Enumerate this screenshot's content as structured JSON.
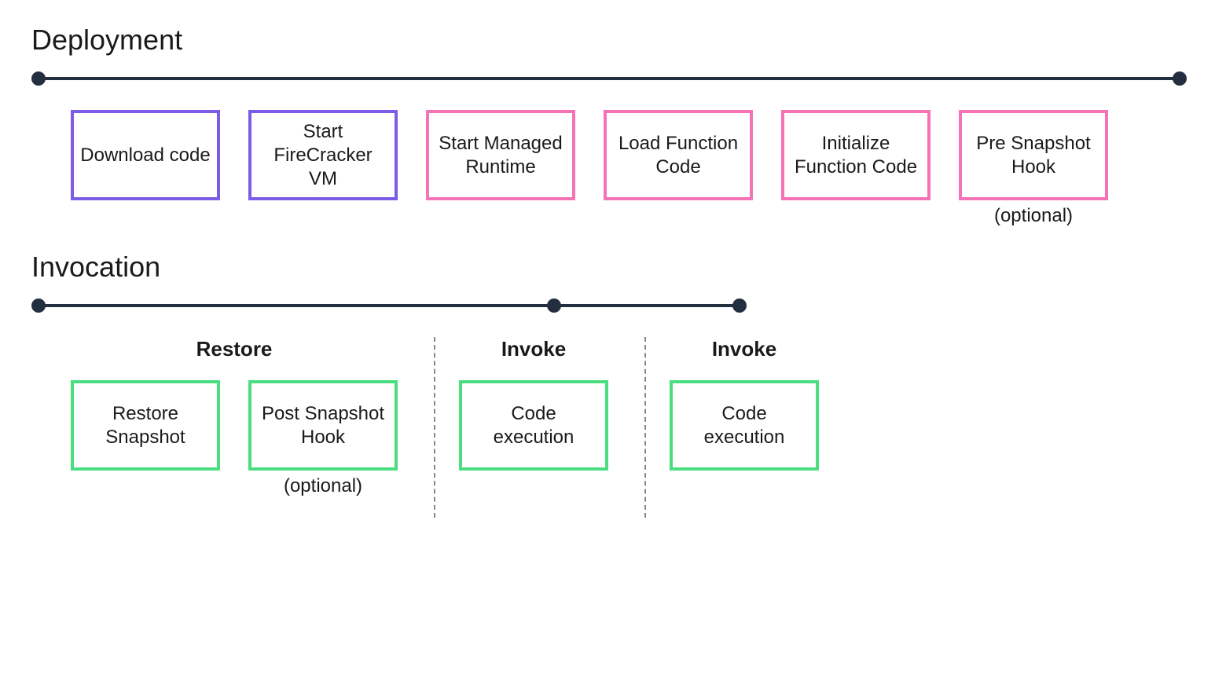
{
  "deployment": {
    "title": "Deployment",
    "steps": [
      {
        "label": "Download code",
        "color": "purple"
      },
      {
        "label": "Start FireCracker VM",
        "color": "purple"
      },
      {
        "label": "Start Managed Runtime",
        "color": "pink"
      },
      {
        "label": "Load Function Code",
        "color": "pink"
      },
      {
        "label": "Initialize Function Code",
        "color": "pink"
      },
      {
        "label": "Pre Snapshot Hook",
        "color": "pink",
        "caption": "(optional)"
      }
    ]
  },
  "invocation": {
    "title": "Invocation",
    "phases": [
      {
        "name": "Restore",
        "steps": [
          {
            "label": "Restore Snapshot",
            "color": "green"
          },
          {
            "label": "Post Snapshot Hook",
            "color": "green",
            "caption": "(optional)"
          }
        ]
      },
      {
        "name": "Invoke",
        "steps": [
          {
            "label": "Code execution",
            "color": "green"
          }
        ]
      },
      {
        "name": "Invoke",
        "steps": [
          {
            "label": "Code execution",
            "color": "green"
          }
        ]
      }
    ]
  }
}
